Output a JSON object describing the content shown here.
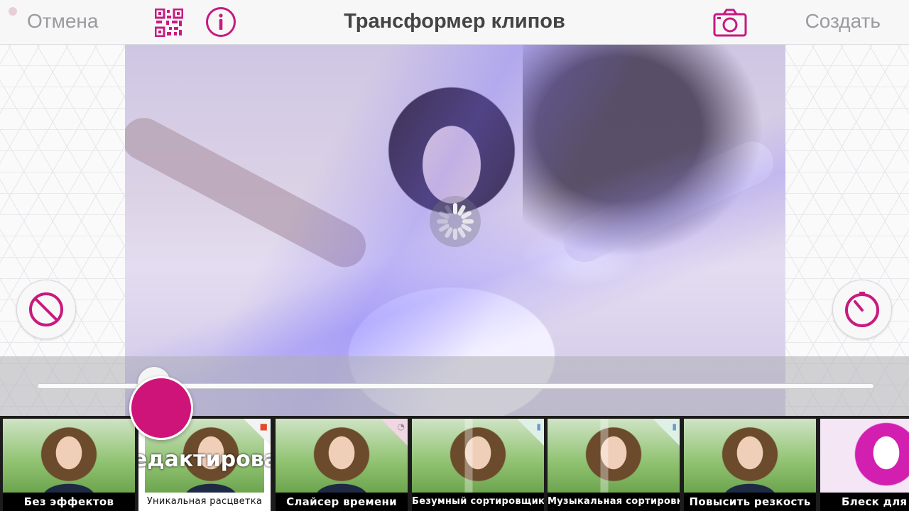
{
  "header": {
    "cancel_label": "Отмена",
    "title": "Трансформер клипов",
    "create_label": "Создать",
    "icons": [
      "qr-code-icon",
      "info-icon",
      "camera-icon"
    ]
  },
  "player": {
    "status": "loading",
    "slider_position": 0.15
  },
  "accent_color": "#cf1479",
  "effects": [
    {
      "label": "Без эффектов",
      "selected": false
    },
    {
      "label": "Уникальная расцветка",
      "selected": true,
      "overlay_text": "едактирова"
    },
    {
      "label": "Слайсер времени",
      "selected": false
    },
    {
      "label": "Безумный сортировщик",
      "selected": false
    },
    {
      "label": "Музыкальная сортировка",
      "selected": false
    },
    {
      "label": "Повысить резкость",
      "selected": false
    },
    {
      "label": "Блеск для",
      "selected": false
    }
  ]
}
